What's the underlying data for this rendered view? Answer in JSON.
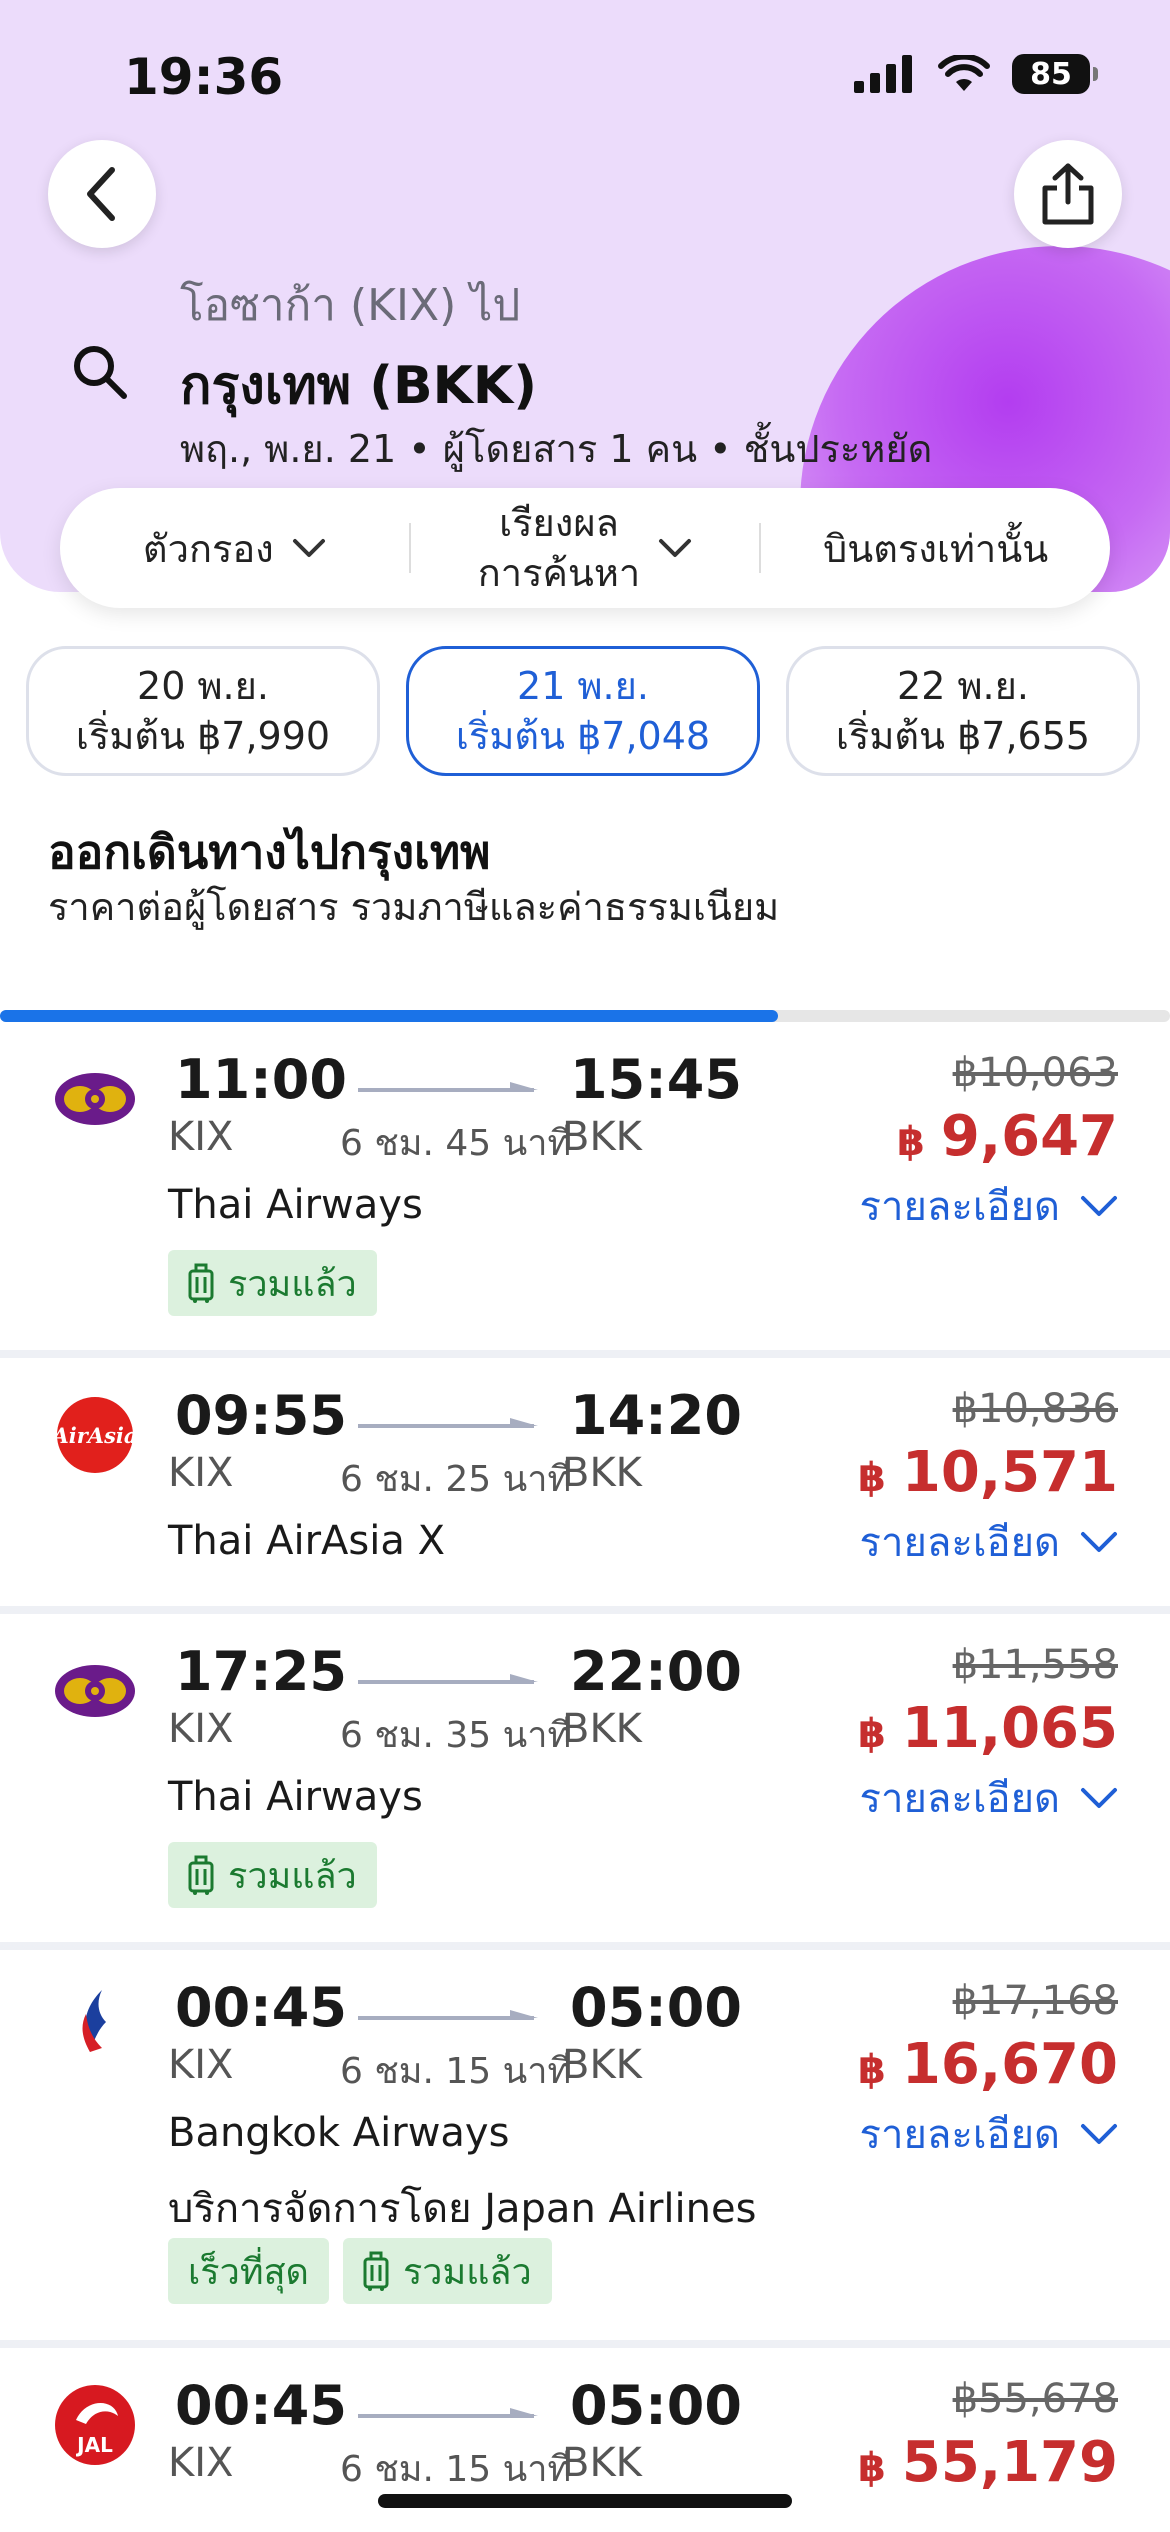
{
  "status_bar": {
    "time": "19:36",
    "battery": "85"
  },
  "header": {
    "route_from": "โอซาก้า (KIX) ไป",
    "route_to": "กรุงเทพ (BKK)",
    "route_meta": "พฤ., พ.ย. 21 • ผู้โดยสาร 1 คน • ชั้นประหยัด"
  },
  "filters": {
    "filter_label": "ตัวกรอง",
    "sort_line1": "เรียงผล",
    "sort_line2": "การค้นหา",
    "nonstop_label": "บินตรงเท่านั้น"
  },
  "dates": [
    {
      "date": "20 พ.ย.",
      "price": "เริ่มต้น ฿7,990",
      "selected": false
    },
    {
      "date": "21 พ.ย.",
      "price": "เริ่มต้น ฿7,048",
      "selected": true
    },
    {
      "date": "22 พ.ย.",
      "price": "เริ่มต้น ฿7,655",
      "selected": false
    }
  ],
  "section": {
    "title": "ออกเดินทางไปกรุงเทพ",
    "subtitle": "ราคาต่อผู้โดยสาร รวมภาษีและค่าธรรมเนียม"
  },
  "loading_progress": 0.665,
  "details_label": "รายละเอียด",
  "currency_symbol": "฿",
  "flights": [
    {
      "logo": "thai-airways-logo",
      "dep_time": "11:00",
      "dep_code": "KIX",
      "arr_time": "15:45",
      "arr_code": "BKK",
      "duration": "6 ชม. 45 นาที",
      "airline": "Thai Airways",
      "operated_by": "",
      "old_price": "฿10,063",
      "price": "9,647",
      "badges": [
        "รวมแล้ว"
      ]
    },
    {
      "logo": "airasia-logo",
      "dep_time": "09:55",
      "dep_code": "KIX",
      "arr_time": "14:20",
      "arr_code": "BKK",
      "duration": "6 ชม. 25 นาที",
      "airline": "Thai AirAsia X",
      "operated_by": "",
      "old_price": "฿10,836",
      "price": "10,571",
      "badges": []
    },
    {
      "logo": "thai-airways-logo",
      "dep_time": "17:25",
      "dep_code": "KIX",
      "arr_time": "22:00",
      "arr_code": "BKK",
      "duration": "6 ชม. 35 นาที",
      "airline": "Thai Airways",
      "operated_by": "",
      "old_price": "฿11,558",
      "price": "11,065",
      "badges": [
        "รวมแล้ว"
      ]
    },
    {
      "logo": "bangkok-airways-logo",
      "dep_time": "00:45",
      "dep_code": "KIX",
      "arr_time": "05:00",
      "arr_code": "BKK",
      "duration": "6 ชม. 15 นาที",
      "airline": "Bangkok Airways",
      "operated_by": "บริการจัดการโดย Japan Airlines",
      "old_price": "฿17,168",
      "price": "16,670",
      "badges": [
        "เร็วที่สุด",
        "รวมแล้ว"
      ]
    },
    {
      "logo": "jal-logo",
      "dep_time": "00:45",
      "dep_code": "KIX",
      "arr_time": "05:00",
      "arr_code": "BKK",
      "duration": "6 ชม. 15 นาที",
      "airline": "",
      "operated_by": "",
      "old_price": "฿55,678",
      "price": "55,179",
      "badges": []
    }
  ]
}
